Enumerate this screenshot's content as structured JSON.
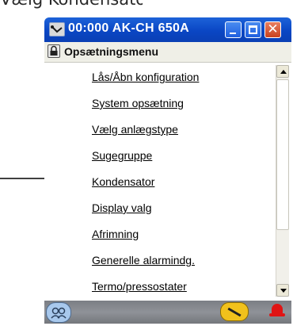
{
  "caption": "Vælg Kondensator",
  "window": {
    "title": "00:000 AK-CH 650A",
    "buttons": {
      "minimize": "minimize",
      "maximize": "maximize",
      "close": "✕"
    }
  },
  "menu": {
    "title": "Opsætningsmenu",
    "items": [
      {
        "label": "Lås/Åbn konfiguration"
      },
      {
        "label": "System opsætning"
      },
      {
        "label": "Vælg anlægstype"
      },
      {
        "label": "Sugegruppe"
      },
      {
        "label": "Kondensator"
      },
      {
        "label": "Display valg"
      },
      {
        "label": "Afrimning"
      },
      {
        "label": "Generelle alarmindg."
      },
      {
        "label": "Termo/pressostater"
      }
    ]
  },
  "colors": {
    "titlebar": "#0a46c4",
    "close_button": "#c9411e",
    "statusbar": "#8f9298",
    "alarm": "#e01414",
    "wrench": "#f1c11c"
  },
  "icons": {
    "app": "thermometer-icon",
    "lock": "lock-icon",
    "status_left": "users-icon",
    "status_mid": "wrench-icon",
    "status_right": "bell-icon"
  }
}
